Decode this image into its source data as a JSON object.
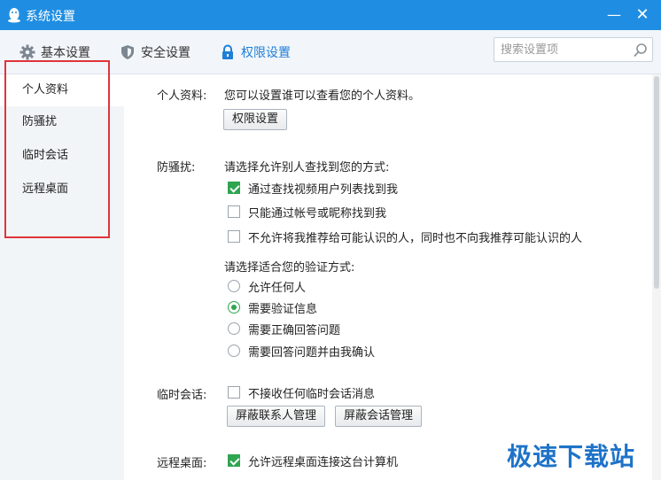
{
  "window": {
    "title": "系统设置",
    "minimize_glyph": "—",
    "close_glyph": "✕"
  },
  "tabs": [
    {
      "label": "基本设置",
      "icon": "gear-icon"
    },
    {
      "label": "安全设置",
      "icon": "shield-icon"
    },
    {
      "label": "权限设置",
      "icon": "lock-icon",
      "active": true
    }
  ],
  "search": {
    "placeholder": "搜索设置项",
    "value": ""
  },
  "sidebar": {
    "items": [
      {
        "label": "个人资料",
        "active": true
      },
      {
        "label": "防骚扰"
      },
      {
        "label": "临时会话"
      },
      {
        "label": "远程桌面"
      }
    ]
  },
  "profile": {
    "label": "个人资料:",
    "desc": "您可以设置谁可以查看您的个人资料。",
    "button": "权限设置"
  },
  "antiharass": {
    "label": "防骚扰:",
    "prompt": "请选择允许别人查找到您的方式:",
    "checkboxes": [
      {
        "label": "通过查找视频用户列表找到我",
        "checked": true
      },
      {
        "label": "只能通过帐号或昵称找到我",
        "checked": false
      },
      {
        "label": "不允许将我推荐给可能认识的人，同时也不向我推荐可能认识的人",
        "checked": false
      }
    ],
    "verify_prompt": "请选择适合您的验证方式:",
    "radios": [
      {
        "label": "允许任何人",
        "checked": false
      },
      {
        "label": "需要验证信息",
        "checked": true
      },
      {
        "label": "需要正确回答问题",
        "checked": false
      },
      {
        "label": "需要回答问题并由我确认",
        "checked": false
      }
    ]
  },
  "temp_chat": {
    "label": "临时会话:",
    "checkbox": {
      "label": "不接收任何临时会话消息",
      "checked": false
    },
    "buttons": [
      "屏蔽联系人管理",
      "屏蔽会话管理"
    ]
  },
  "remote": {
    "label": "远程桌面:",
    "checkbox": {
      "label": "允许远程桌面连接这台计算机",
      "checked": true
    }
  },
  "watermark": "极速下载站",
  "colors": {
    "titlebar": "#1f8ee2",
    "accent": "#1f7fd6",
    "check_green": "#2fa550",
    "highlight_red": "#e0343a"
  }
}
